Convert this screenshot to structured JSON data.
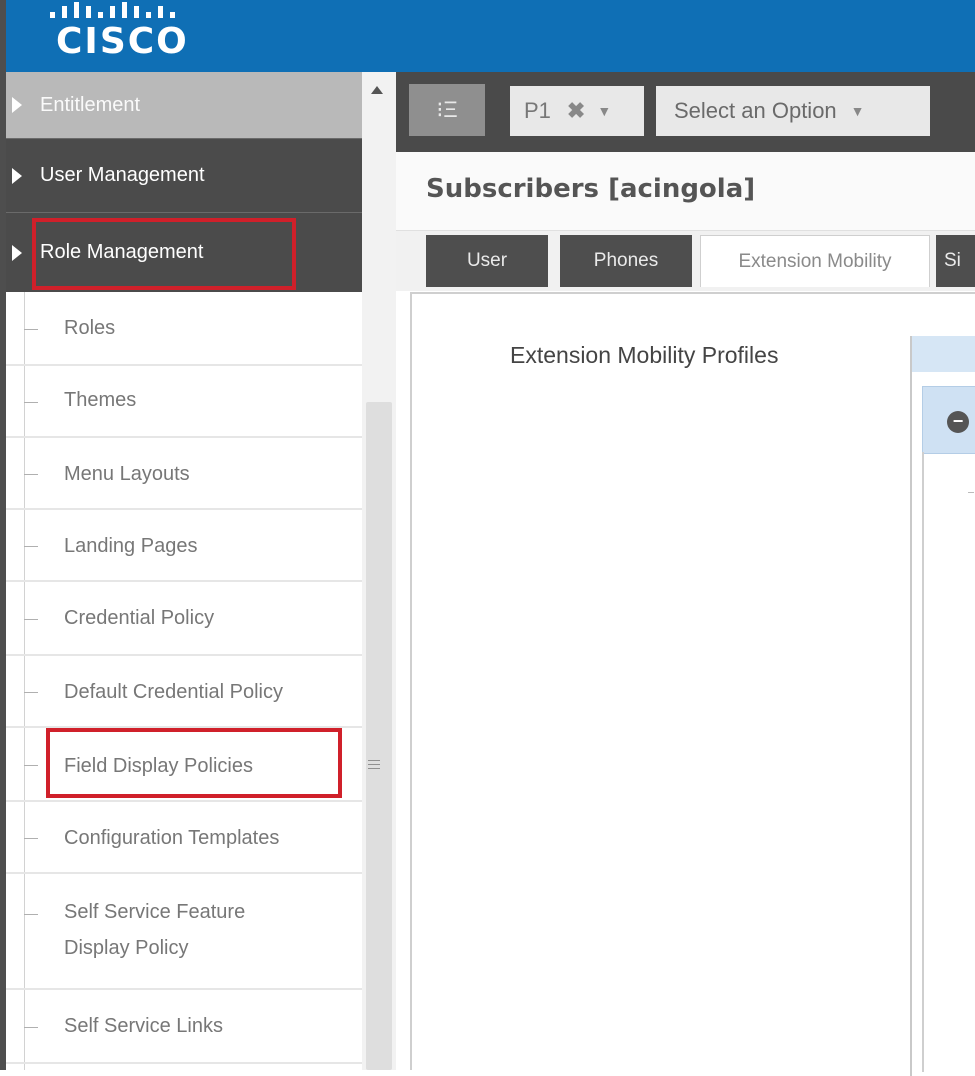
{
  "brand": {
    "logo_text": "CISCO",
    "color": "#0f6fb5"
  },
  "sidebar": {
    "headers": [
      {
        "label": "Entitlement",
        "icon": "triangle-right-icon"
      },
      {
        "label": "User Management",
        "icon": "triangle-right-icon"
      },
      {
        "label": "Role Management",
        "icon": "triangle-right-icon"
      }
    ],
    "items": [
      {
        "label": "Roles"
      },
      {
        "label": "Themes"
      },
      {
        "label": "Menu Layouts"
      },
      {
        "label": "Landing Pages"
      },
      {
        "label": "Credential Policy"
      },
      {
        "label": "Default Credential Policy"
      },
      {
        "label": "Field Display Policies"
      },
      {
        "label": "Configuration Templates"
      },
      {
        "label": "Self Service Feature",
        "label2": "Display Policy"
      },
      {
        "label": "Self Service Links"
      }
    ],
    "highlight_color": "#d0202a"
  },
  "toolbar": {
    "menu_icon_glyph": "⁝Ξ",
    "tag_label": "P1",
    "tag_remove_glyph": "✖",
    "caret_glyph": "▼",
    "select_placeholder": "Select an Option"
  },
  "page": {
    "title": "Subscribers [acingola]"
  },
  "tabs": [
    {
      "label": "User",
      "state": "dark"
    },
    {
      "label": "Phones",
      "state": "dark"
    },
    {
      "label": "Extension Mobility",
      "state": "active"
    },
    {
      "label": "Si",
      "state": "dark"
    }
  ],
  "content": {
    "section_label": "Extension Mobility Profiles",
    "collapse_glyph": "−"
  }
}
